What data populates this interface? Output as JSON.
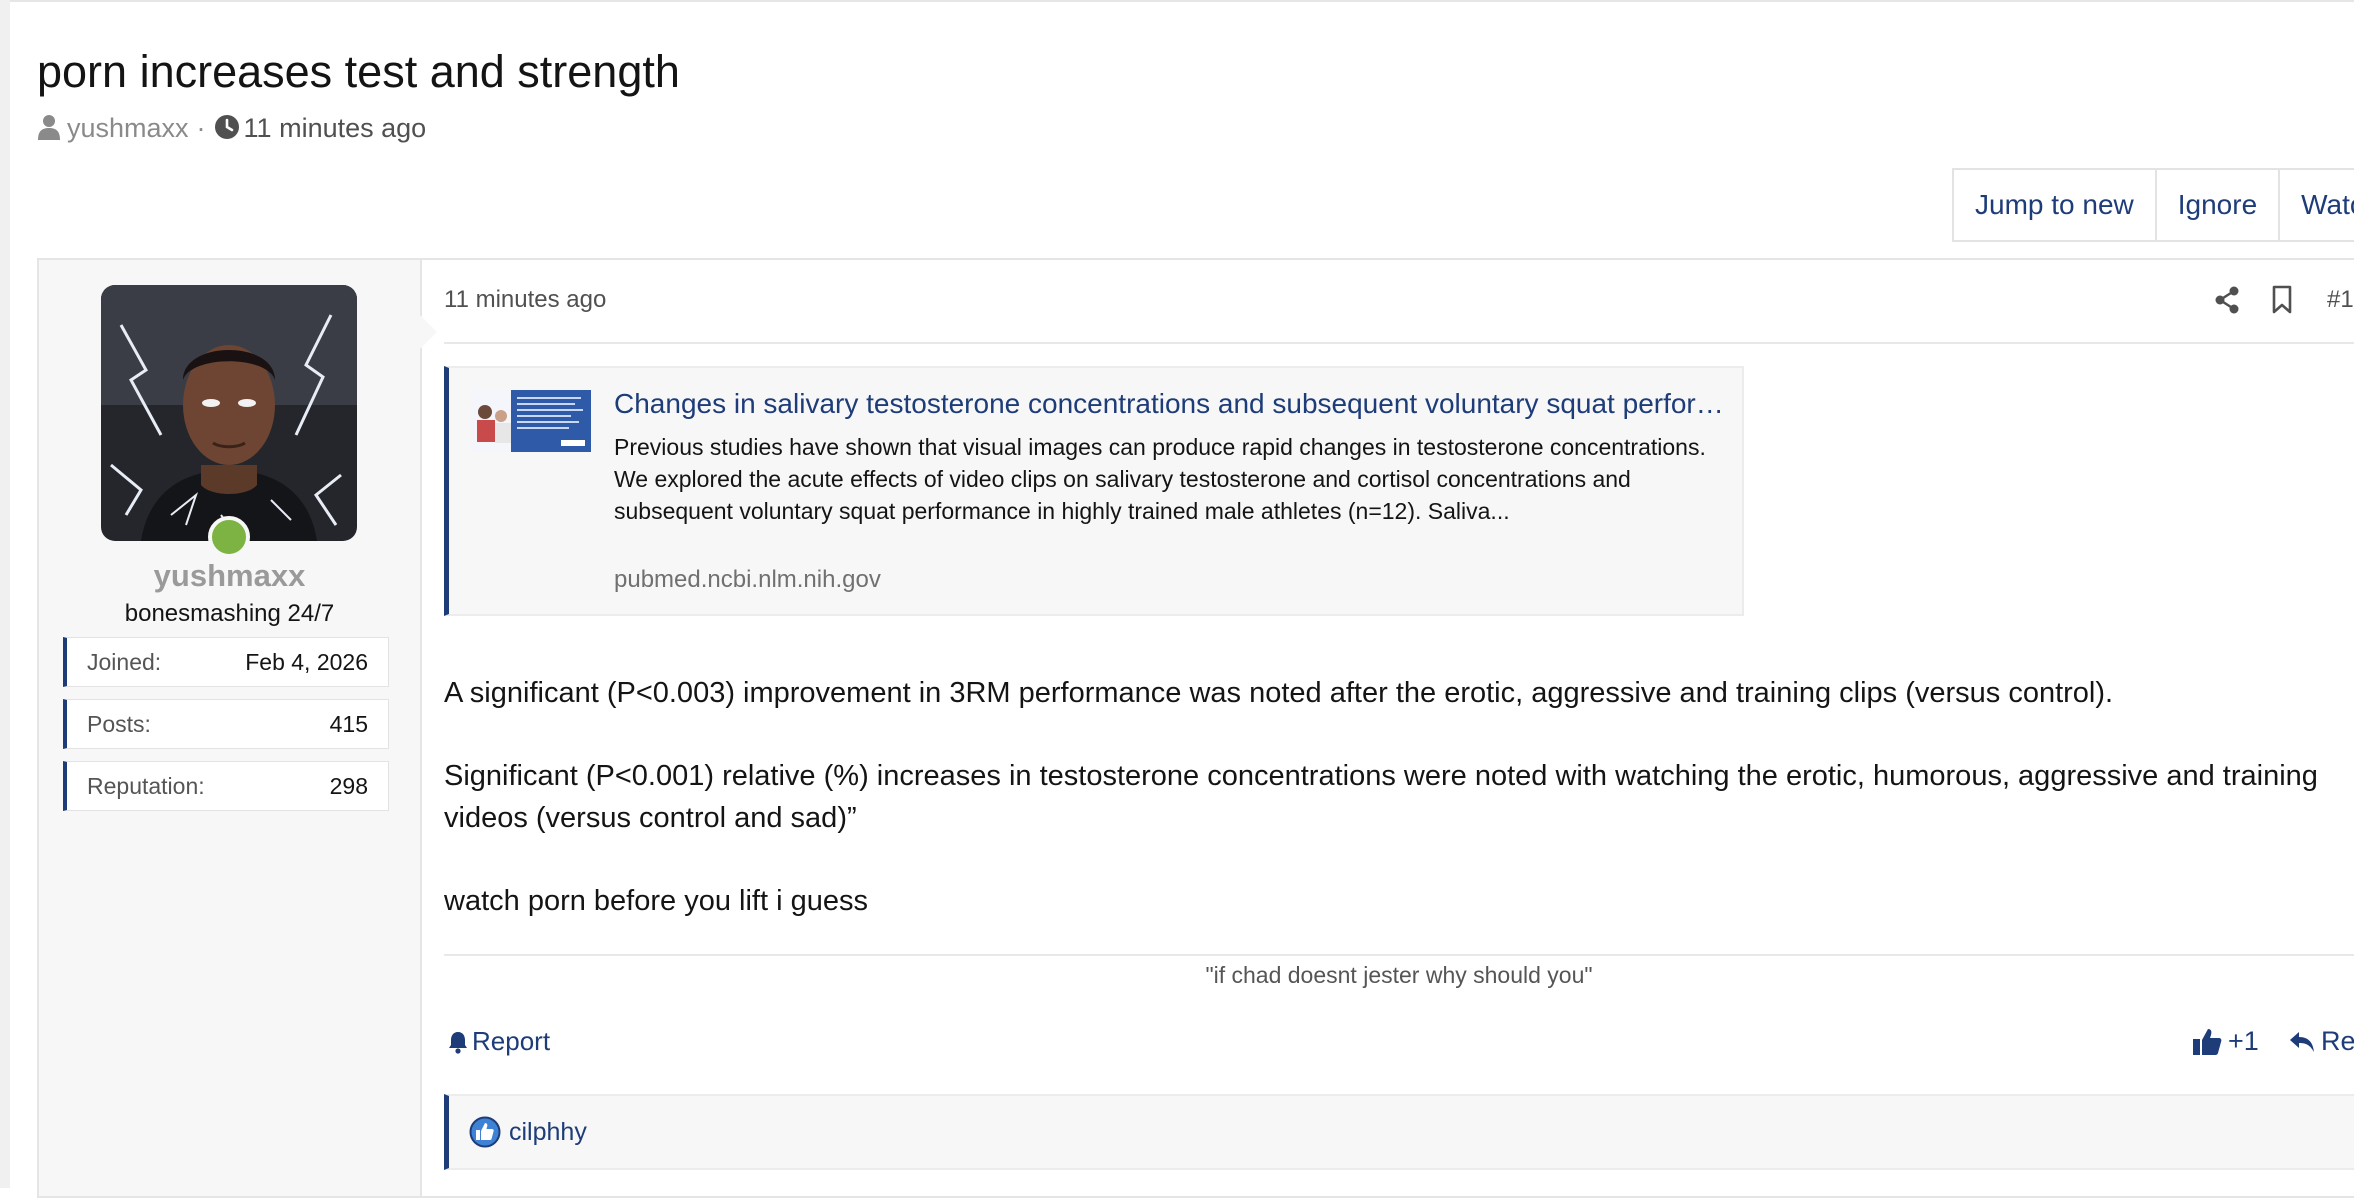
{
  "thread": {
    "title": "porn increases test and strength",
    "author": "yushmaxx",
    "separator": "·",
    "time": "11 minutes ago"
  },
  "actions": {
    "jump_to_new": "Jump to new",
    "ignore": "Ignore",
    "watch": "Watch"
  },
  "user": {
    "name": "yushmaxx",
    "title": "bonesmashing 24/7",
    "online": true,
    "stats": [
      {
        "label": "Joined:",
        "value": "Feb 4, 2026"
      },
      {
        "label": "Posts:",
        "value": "415"
      },
      {
        "label": "Reputation:",
        "value": "298"
      }
    ]
  },
  "post": {
    "date": "11 minutes ago",
    "number": "#1",
    "embed": {
      "title": "Changes in salivary testosterone concentrations and subsequent voluntary squat performance following the presentation of short video clips",
      "description": "Previous studies have shown that visual images can produce rapid changes in testosterone concentrations. We explored the acute effects of video clips on salivary testosterone and cortisol concentrations and subsequent voluntary squat performance in highly trained male athletes (n=12). Saliva...",
      "domain": "pubmed.ncbi.nlm.nih.gov"
    },
    "paragraphs": [
      "A significant (P<0.003) improvement in 3RM performance was noted after the erotic, aggressive and training clips (versus control).",
      "Significant (P<0.001) relative (%) increases in testosterone concentrations were noted with watching the erotic, humorous, aggressive and training videos (versus control and sad)”",
      "watch porn before you lift i guess"
    ],
    "signature": "\"if chad doesnt jester why should you\"",
    "report_label": "Report",
    "like_label": "+1",
    "reply_label": "Reply",
    "reactions": {
      "users": "cilphhy"
    }
  },
  "colors": {
    "accent": "#1d3c78",
    "online": "#7cb342",
    "muted": "#8a8a8a"
  }
}
